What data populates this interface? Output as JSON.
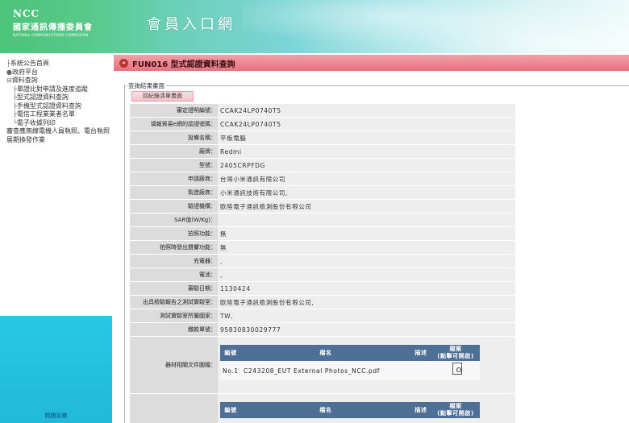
{
  "header": {
    "logo_abbr": "NCC",
    "logo_zh": "國家通訊傳播委員會",
    "logo_en": "NATIONAL COMMUNICATIONS COMMISSION",
    "site_title": "會員入口網"
  },
  "sidebar": {
    "items": [
      {
        "sym": "├",
        "label": "系統公告首頁"
      },
      {
        "sym": "●",
        "label": "政府平台"
      },
      {
        "sym": "⊟",
        "label": "資料查詢"
      }
    ],
    "sub_items": [
      {
        "sym": "├",
        "label": "單證比對申請及進度追蹤"
      },
      {
        "sym": "├",
        "label": "型式認證資料查詢"
      },
      {
        "sym": "├",
        "label": "手機型式認證資料查詢"
      },
      {
        "sym": "├",
        "label": "電信工程業業者名單"
      },
      {
        "sym": "└",
        "label": "電子收據列印"
      }
    ],
    "extra_item": "審查應無線電機人員執照、電台執照展期換發作業",
    "footer_label": "問題反應"
  },
  "main": {
    "page_title": "FUN016 型式認證資料查詢",
    "legend": "查詢結果畫面",
    "back_button": "回紀錄清單畫面",
    "rows": [
      {
        "label": "審定證明編號：",
        "value": "CCAK24LP0740T5"
      },
      {
        "label": "填報貿易e網的認證號碼：",
        "value": "CCAK24LP0740T5"
      },
      {
        "label": "設備名稱：",
        "value": "平板電腦"
      },
      {
        "label": "廠牌：",
        "value": "Redmi"
      },
      {
        "label": "型號：",
        "value": "2405CRPFDG"
      },
      {
        "label": "申請廠商：",
        "value": "台灣小米通訊有限公司"
      },
      {
        "label": "製造廠商：",
        "value": "小米通訊技術有限公司,"
      },
      {
        "label": "驗證機構：",
        "value": "歐陸電子通訊檢測股份有限公司"
      },
      {
        "label": "SAR值(W/Kg)：",
        "value": ""
      },
      {
        "label": "拍照功能：",
        "value": "無"
      },
      {
        "label": "拍照時發出聲響功能：",
        "value": "無"
      },
      {
        "label": "充電器：",
        "value": ","
      },
      {
        "label": "電池：",
        "value": ","
      },
      {
        "label": "審驗日期：",
        "value": "1130424"
      },
      {
        "label": "出具檢驗報告之測試實驗室：",
        "value": "歐陸電子通訊檢測股份有限公司,"
      },
      {
        "label": "測試實驗室所屬國家：",
        "value": "TW,"
      },
      {
        "label": "繳款單號：",
        "value": "95830830029777"
      }
    ],
    "files_label": "器材相關文件圖檔：",
    "file_table": {
      "headers": [
        "編號",
        "檔名",
        "描述",
        "檔案\n(點擊可開啟)"
      ],
      "rows": [
        {
          "no": "No.1",
          "name": "C243208_EUT External Photos_NCC.pdf",
          "desc": ""
        }
      ]
    },
    "file_table2": {
      "headers": [
        "編號",
        "檔名",
        "描述",
        "檔案\n(點擊可開啟)"
      ]
    }
  }
}
